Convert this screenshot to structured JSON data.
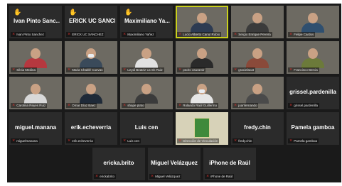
{
  "gallery": {
    "rows": [
      [
        {
          "display": "Ivan Pinto Sanc...",
          "caption": "Ivan Pinto Sanchez",
          "type": "name",
          "hand": true
        },
        {
          "display": "ERICK UC SANCH...",
          "caption": "ERICK UC SANCHEZ",
          "type": "name",
          "hand": true
        },
        {
          "display": "Maximiliano Ya...",
          "caption": "Maximiliano Yañez",
          "type": "name",
          "hand": true
        },
        {
          "caption": "Lucio Alberto Canul Rubio",
          "type": "video",
          "bg": "bg-light",
          "shirt": "#2d3b52",
          "active": true
        },
        {
          "caption": "Sergio Enrique Pereira",
          "type": "video",
          "bg": "bg-warm",
          "shirt": "#3b3b3b"
        },
        {
          "caption": "Felipe Cardos",
          "type": "video",
          "bg": "bg-cool",
          "shirt": "#2f4f6f"
        }
      ],
      [
        {
          "caption": "Silvia Medina",
          "type": "video",
          "bg": "bg-light",
          "shirt": "#b6383f"
        },
        {
          "caption": "Maria Chablé Cuevas",
          "type": "video",
          "bg": "bg-cool",
          "shirt": "#3a4a5a",
          "mask": true
        },
        {
          "caption": "Leydi Beatriz Uc Ek Ruiz",
          "type": "video",
          "bg": "bg-warm",
          "shirt": "#e2e2e2"
        },
        {
          "caption": "pedro osuramir",
          "type": "video",
          "bg": "bg-dark",
          "shirt": "#2a2a2a"
        },
        {
          "caption": "gracielacat",
          "type": "video",
          "bg": "bg-warm",
          "shirt": "#8a4a3a"
        },
        {
          "caption": "Francisco Bercia",
          "type": "video",
          "bg": "bg-light",
          "shirt": "#6c7a3a"
        }
      ],
      [
        {
          "caption": "Carolina Reyes Ruiz",
          "type": "video",
          "bg": "bg-light",
          "shirt": "#d8d8d8"
        },
        {
          "caption": "Omar Díaz Baez",
          "type": "video",
          "bg": "bg-cool",
          "shirt": "#1f2a38"
        },
        {
          "caption": "shape plato",
          "type": "video",
          "bg": "bg-dark",
          "shirt": "#3b3b3b"
        },
        {
          "caption": "Rolando Raúl Guillermo",
          "type": "video",
          "bg": "bg-green",
          "shirt": "#e6e6e6",
          "mask": true
        },
        {
          "caption": "juanfernando",
          "type": "video",
          "bg": "bg-light",
          "shirt": "#4a4a4a"
        },
        {
          "display": "grissel.pardenilla",
          "caption": "grissel.pardenilla",
          "type": "name"
        }
      ],
      [
        {
          "display": "miguel.manana",
          "caption": "miguelmanana",
          "type": "name"
        },
        {
          "display": "erik.echeverria",
          "caption": "erik.echeverria",
          "type": "name"
        },
        {
          "display": "Luis cen",
          "caption": "Luis cen",
          "type": "name"
        },
        {
          "caption": "Dirección de Vinculación",
          "type": "book"
        },
        {
          "display": "fredy.chin",
          "caption": "fredy.chin",
          "type": "name"
        },
        {
          "display": "Pamela gamboa",
          "caption": "Pamela gamboa",
          "type": "name"
        }
      ],
      [
        {
          "display": "ericka.brito",
          "caption": "erickabrito",
          "type": "name"
        },
        {
          "display": "Miguel Velázquez",
          "caption": "Miguel Velázquez",
          "type": "name"
        },
        {
          "display": "iPhone de Raúl",
          "caption": "iPhone de Raúl",
          "type": "name"
        }
      ]
    ]
  },
  "colors": {
    "background": "#1a1a1a",
    "tile": "#2b2b2b",
    "mute_icon": "#e0302b",
    "raised_hand": "#f2c318",
    "active_speaker_border": "#c9cf1c"
  }
}
